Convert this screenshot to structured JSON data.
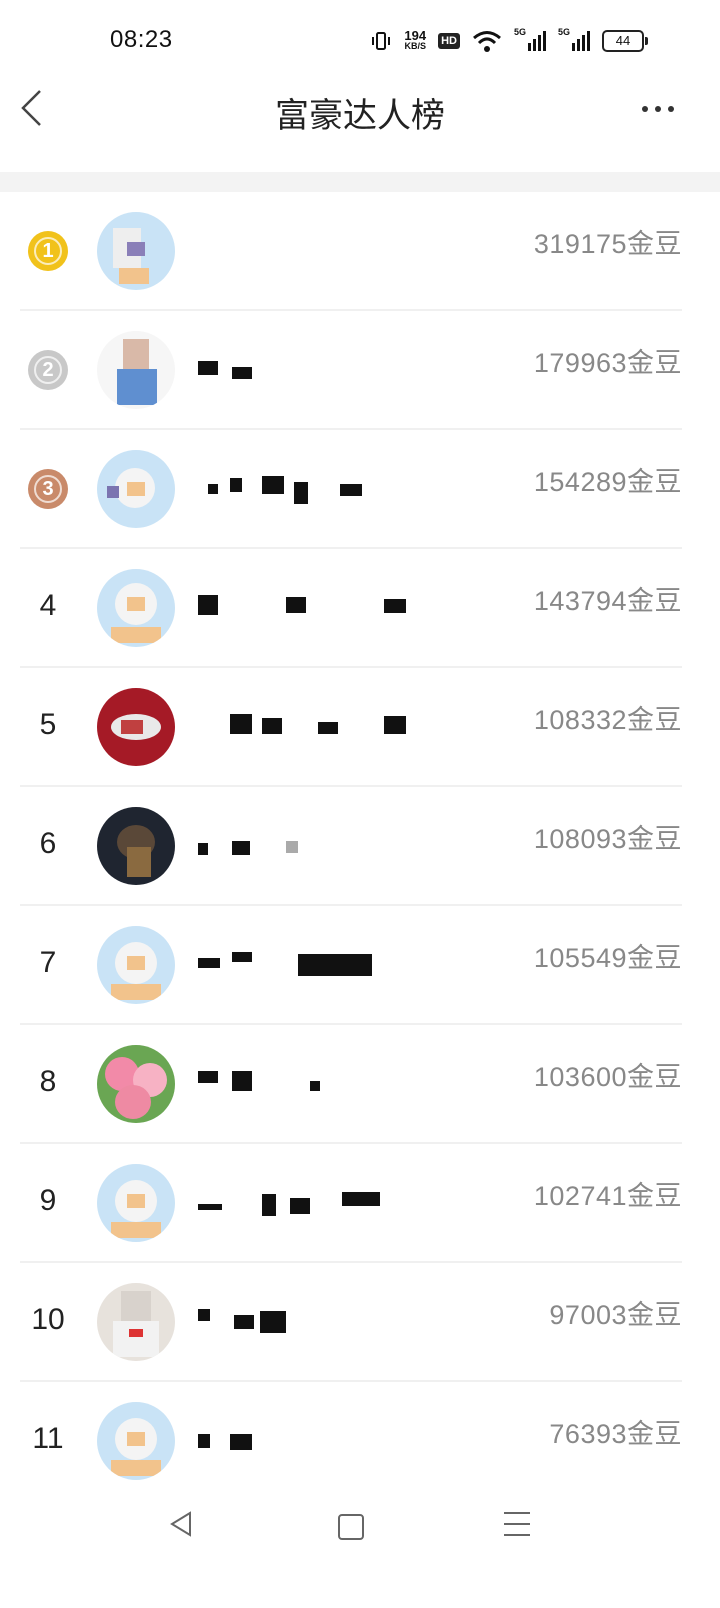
{
  "status_bar": {
    "time": "08:23",
    "net_speed": "194",
    "net_unit": "KB/S",
    "hd_badge": "HD",
    "signal_1_label": "5G",
    "signal_2_label": "5G",
    "battery": "44"
  },
  "header": {
    "title": "富豪达人榜",
    "back_icon": "chevron-left-icon",
    "more_icon": "more-dots-icon"
  },
  "ranking": [
    {
      "rank": "1",
      "medal": "gold",
      "score": "319175金豆"
    },
    {
      "rank": "2",
      "medal": "silver",
      "score": "179963金豆"
    },
    {
      "rank": "3",
      "medal": "bronze",
      "score": "154289金豆"
    },
    {
      "rank": "4",
      "score": "143794金豆"
    },
    {
      "rank": "5",
      "score": "108332金豆"
    },
    {
      "rank": "6",
      "score": "108093金豆"
    },
    {
      "rank": "7",
      "score": "105549金豆"
    },
    {
      "rank": "8",
      "score": "103600金豆"
    },
    {
      "rank": "9",
      "score": "102741金豆"
    },
    {
      "rank": "10",
      "score": "97003金豆"
    },
    {
      "rank": "11",
      "score": "76393金豆"
    }
  ],
  "colors": {
    "gold": "#f1c21b",
    "silver": "#c8c8c8",
    "bronze": "#c98a6a",
    "score_text": "#888888"
  },
  "nav_bar": {
    "back_icon": "triangle-back-icon",
    "home_icon": "square-home-icon",
    "menu_icon": "menu-lines-icon"
  }
}
